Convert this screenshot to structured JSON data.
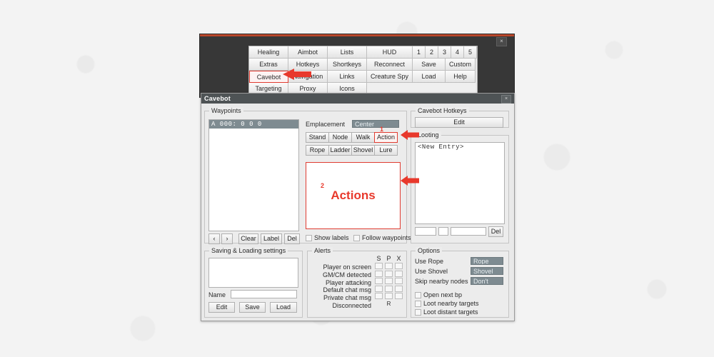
{
  "app": {
    "close_label": "×",
    "accent_color": "#b8462a",
    "frame_color": "#373737"
  },
  "menu": {
    "rows": [
      [
        {
          "label": "Healing",
          "w": "w-a"
        },
        {
          "label": "Aimbot",
          "w": "w-b"
        },
        {
          "label": "Lists",
          "w": "w-c"
        },
        {
          "label": "HUD",
          "w": "w-d"
        },
        {
          "label": "1",
          "w": "w-e"
        },
        {
          "label": "2",
          "w": "w-e"
        },
        {
          "label": "3",
          "w": "w-e"
        },
        {
          "label": "4",
          "w": "w-e"
        },
        {
          "label": "5",
          "w": "w-e"
        }
      ],
      [
        {
          "label": "Extras",
          "w": "w-a"
        },
        {
          "label": "Hotkeys",
          "w": "w-b"
        },
        {
          "label": "Shortkeys",
          "w": "w-c"
        },
        {
          "label": "Reconnect",
          "w": "w-d"
        },
        {
          "label": "Save",
          "w": "w-f"
        },
        {
          "label": "Custom",
          "w": "w-g"
        }
      ],
      [
        {
          "label": "Cavebot",
          "w": "w-a",
          "state": "highlight"
        },
        {
          "label": "Navigation",
          "w": "w-b"
        },
        {
          "label": "Links",
          "w": "w-c"
        },
        {
          "label": "Creature Spy",
          "w": "w-d"
        },
        {
          "label": "Load",
          "w": "w-f"
        },
        {
          "label": "Help",
          "w": "w-g"
        }
      ],
      [
        {
          "label": "Targeting",
          "w": "w-a"
        },
        {
          "label": "Proxy",
          "w": "w-b"
        },
        {
          "label": "Icons",
          "w": "w-c"
        },
        {
          "label": "",
          "w": "w-d",
          "state": "blank"
        },
        {
          "label": "",
          "w": "w-f",
          "state": "blank"
        },
        {
          "label": "",
          "w": "w-g",
          "state": "blank"
        }
      ]
    ]
  },
  "cavebot": {
    "title": "Cavebot",
    "close_label": "×",
    "waypoints": {
      "group_label": "Waypoints",
      "entries": [
        "A 000:  0  0  0"
      ],
      "prev_label": "‹",
      "next_label": "›",
      "clear_label": "Clear",
      "label_button": "Label",
      "del_label": "Del",
      "show_labels": "Show labels",
      "follow_waypoints": "Follow waypoints"
    },
    "emplacement": {
      "label": "Emplacement",
      "value": "Center",
      "type_buttons_row1": [
        "Stand",
        "Node",
        "Walk",
        "Action"
      ],
      "type_buttons_row2": [
        "Rope",
        "Ladder",
        "Shovel",
        "Lure"
      ],
      "selected_button": "Action",
      "actions_preview": "Actions"
    },
    "hotkeys": {
      "group_label": "Cavebot Hotkeys",
      "edit_label": "Edit"
    },
    "looting": {
      "group_label": "Looting",
      "entries": [
        "<New Entry>"
      ],
      "field1": "",
      "field2": "",
      "field3": "",
      "del_label": "Del"
    },
    "saving": {
      "group_label": "Saving & Loading settings",
      "entries": [],
      "name_label": "Name",
      "name_value": "",
      "edit_label": "Edit",
      "save_label": "Save",
      "load_label": "Load"
    },
    "alerts": {
      "group_label": "Alerts",
      "columns": [
        "S",
        "P",
        "X"
      ],
      "rows": [
        {
          "name": "Player on screen",
          "cells": [
            "box",
            "box",
            "box"
          ]
        },
        {
          "name": "GM/CM detected",
          "cells": [
            "box",
            "box",
            "box"
          ]
        },
        {
          "name": "Player attacking",
          "cells": [
            "box",
            "box",
            "box"
          ]
        },
        {
          "name": "Default chat msg",
          "cells": [
            "box",
            "box",
            "box"
          ]
        },
        {
          "name": "Private chat msg",
          "cells": [
            "box",
            "box",
            "box"
          ]
        },
        {
          "name": "Disconnected",
          "cells": [
            "blank",
            "R",
            "blank"
          ]
        }
      ]
    },
    "options": {
      "group_label": "Options",
      "selects": [
        {
          "label": "Use Rope",
          "value": "Rope"
        },
        {
          "label": "Use Shovel",
          "value": "Shovel"
        },
        {
          "label": "Skip nearby nodes",
          "value": "Don't"
        }
      ],
      "checkboxes": [
        {
          "label": "Open next bp"
        },
        {
          "label": "Loot nearby targets"
        },
        {
          "label": "Loot distant targets"
        }
      ]
    }
  },
  "annotations": {
    "marker_1": "1",
    "marker_2": "2",
    "color": "#e8392c"
  }
}
